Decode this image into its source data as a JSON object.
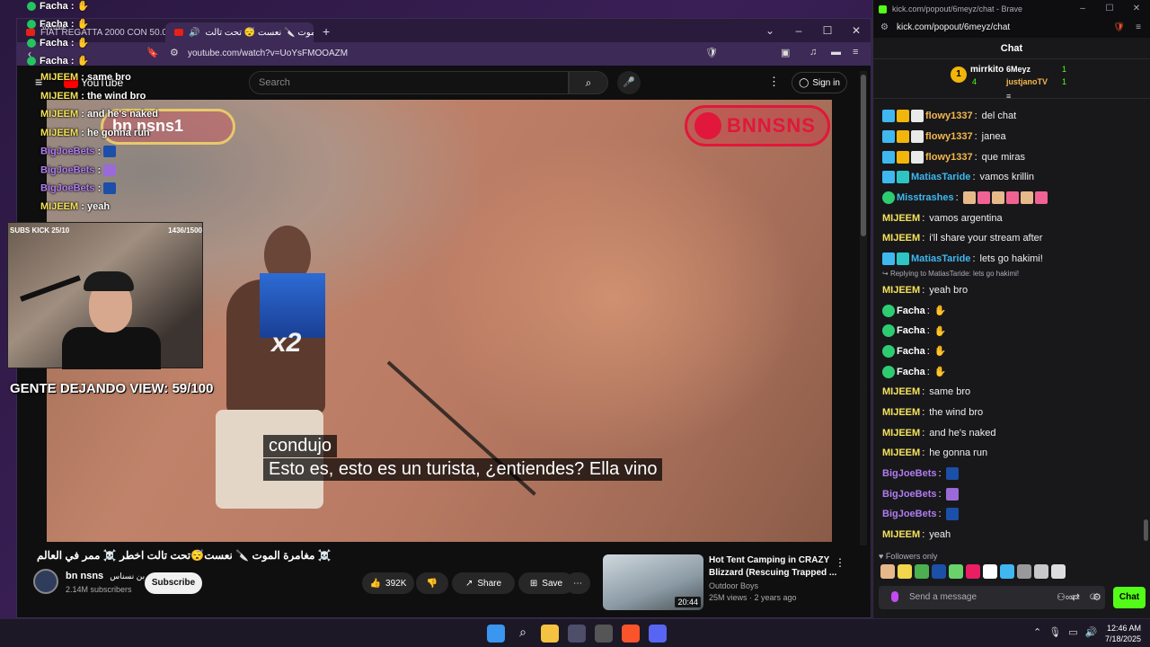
{
  "browser": {
    "tabs": [
      {
        "label": "FIAT REGATTA 2000 CON 50.000 KILÓ"
      },
      {
        "label": "مغامرة الموت 🔪 نعست 😴 تحت تالت ..."
      }
    ],
    "url": "youtube.com/watch?v=UoYsFMOOAZM"
  },
  "youtube": {
    "logo": "YouTube",
    "search_placeholder": "Search",
    "signin": "Sign in",
    "subtitle_line1": "condujo",
    "subtitle_line2": "Esto es, esto es un turista, ¿entiendes? Ella vino",
    "watermark": "BNNSNS",
    "watermark2": "bn nsns1",
    "sticker_text": "x2",
    "video_title": "مغامرة الموت 🔪 نعست😴تحت تالت اخطر ☠️ ممر في العالم ☠️",
    "channel_name": "bn nsns",
    "channel_arabic": "بن نسناس",
    "subscribers": "2.14M subscribers",
    "subscribe": "Subscribe",
    "likes": "392K",
    "share": "Share",
    "save": "Save",
    "rec": {
      "title": "Hot Tent Camping in CRAZY Blizzard (Rescuing Trapped ...",
      "channel": "Outdoor Boys",
      "meta": "25M views · 2 years ago",
      "duration": "20:44"
    }
  },
  "overlay": {
    "top_facha": [
      "Facha :",
      "Facha :",
      "Facha :",
      "Facha :"
    ],
    "yt_mini": "YouTube",
    "chat": [
      {
        "user": "MIJEEM",
        "text": "same bro",
        "kind": "yellow"
      },
      {
        "user": "MIJEEM",
        "text": "the wind bro",
        "kind": "yellow"
      },
      {
        "user": "MIJEEM",
        "text": "and he's naked",
        "kind": "yellow"
      },
      {
        "user": "MIJEEM",
        "text": "he gonna run",
        "kind": "yellow"
      },
      {
        "user": "BigJoeBets",
        "text": "",
        "kind": "purple"
      },
      {
        "user": "BigJoeBets",
        "text": "",
        "kind": "purple"
      },
      {
        "user": "BigJoeBets",
        "text": "",
        "kind": "purple"
      },
      {
        "user": "MIJEEM",
        "text": "yeah",
        "kind": "yellow"
      }
    ],
    "webcam_left": "SUBS KICK 25/10",
    "webcam_right": "1436/1500",
    "gente": "GENTE DEJANDO VIEW: 59/100"
  },
  "chatwin": {
    "title": "kick.com/popout/6meyz/chat - Brave",
    "url": "kick.com/popout/6meyz/chat",
    "header": "Chat",
    "leader": {
      "rank": "1",
      "name": "mirrkito",
      "count": "4",
      "r1": "6Meyz",
      "r1c": "1",
      "r2": "justjanoTV",
      "r2c": "1"
    },
    "messages": [
      {
        "user": "flowy1337",
        "text": "del chat",
        "color": "#f5b74a"
      },
      {
        "user": "flowy1337",
        "text": "janea",
        "color": "#f5b74a"
      },
      {
        "user": "flowy1337",
        "text": "que miras",
        "color": "#f5b74a"
      },
      {
        "user": "MatiasTaride",
        "text": "vamos krillin",
        "color": "#3fb8f0"
      },
      {
        "user": "Misstrashes",
        "text": "",
        "color": "#3fb8f0"
      },
      {
        "user": "MIJEEM",
        "text": "vamos argentina",
        "color": "#f5e35a"
      },
      {
        "user": "MIJEEM",
        "text": "i'll share your stream after",
        "color": "#f5e35a"
      },
      {
        "user": "MatiasTaride",
        "text": "lets go hakimi!",
        "color": "#3fb8f0"
      }
    ],
    "reply_note": "Replying to MatiasTaride: lets go hakimi!",
    "messages2": [
      {
        "user": "MIJEEM",
        "text": "yeah bro",
        "color": "#f5e35a"
      },
      {
        "user": "Facha",
        "text": "",
        "color": "#ffffff"
      },
      {
        "user": "Facha",
        "text": "",
        "color": "#ffffff"
      },
      {
        "user": "Facha",
        "text": "",
        "color": "#ffffff"
      },
      {
        "user": "Facha",
        "text": "",
        "color": "#ffffff"
      },
      {
        "user": "MIJEEM",
        "text": "same bro",
        "color": "#f5e35a"
      },
      {
        "user": "MIJEEM",
        "text": "the wind bro",
        "color": "#f5e35a"
      },
      {
        "user": "MIJEEM",
        "text": "and he's naked",
        "color": "#f5e35a"
      },
      {
        "user": "MIJEEM",
        "text": "he gonna run",
        "color": "#f5e35a"
      },
      {
        "user": "BigJoeBets",
        "text": "",
        "color": "#b07cf0"
      },
      {
        "user": "BigJoeBets",
        "text": "",
        "color": "#b07cf0"
      },
      {
        "user": "BigJoeBets",
        "text": "",
        "color": "#b07cf0"
      },
      {
        "user": "MIJEEM",
        "text": "yeah",
        "color": "#f5e35a"
      }
    ],
    "followers_only": "Followers only",
    "send_placeholder": "Send a message",
    "chat_button": "Chat"
  },
  "taskbar": {
    "time": "12:46 AM",
    "date": "7/18/2025"
  }
}
